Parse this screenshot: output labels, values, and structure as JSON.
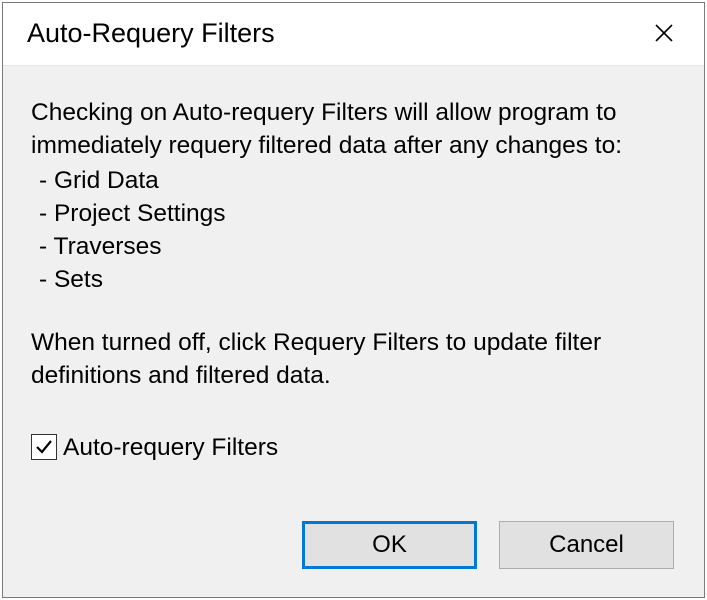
{
  "dialog": {
    "title": "Auto-Requery Filters",
    "intro": "Checking on Auto-requery Filters will allow program to immediately requery filtered data after any changes to:",
    "bullets": [
      "Grid Data",
      "Project Settings",
      "Traverses",
      "Sets"
    ],
    "off_note": "When turned off, click Requery Filters to update filter definitions and filtered data.",
    "checkbox_label": "Auto-requery Filters",
    "checkbox_checked": true,
    "ok_label": "OK",
    "cancel_label": "Cancel"
  }
}
